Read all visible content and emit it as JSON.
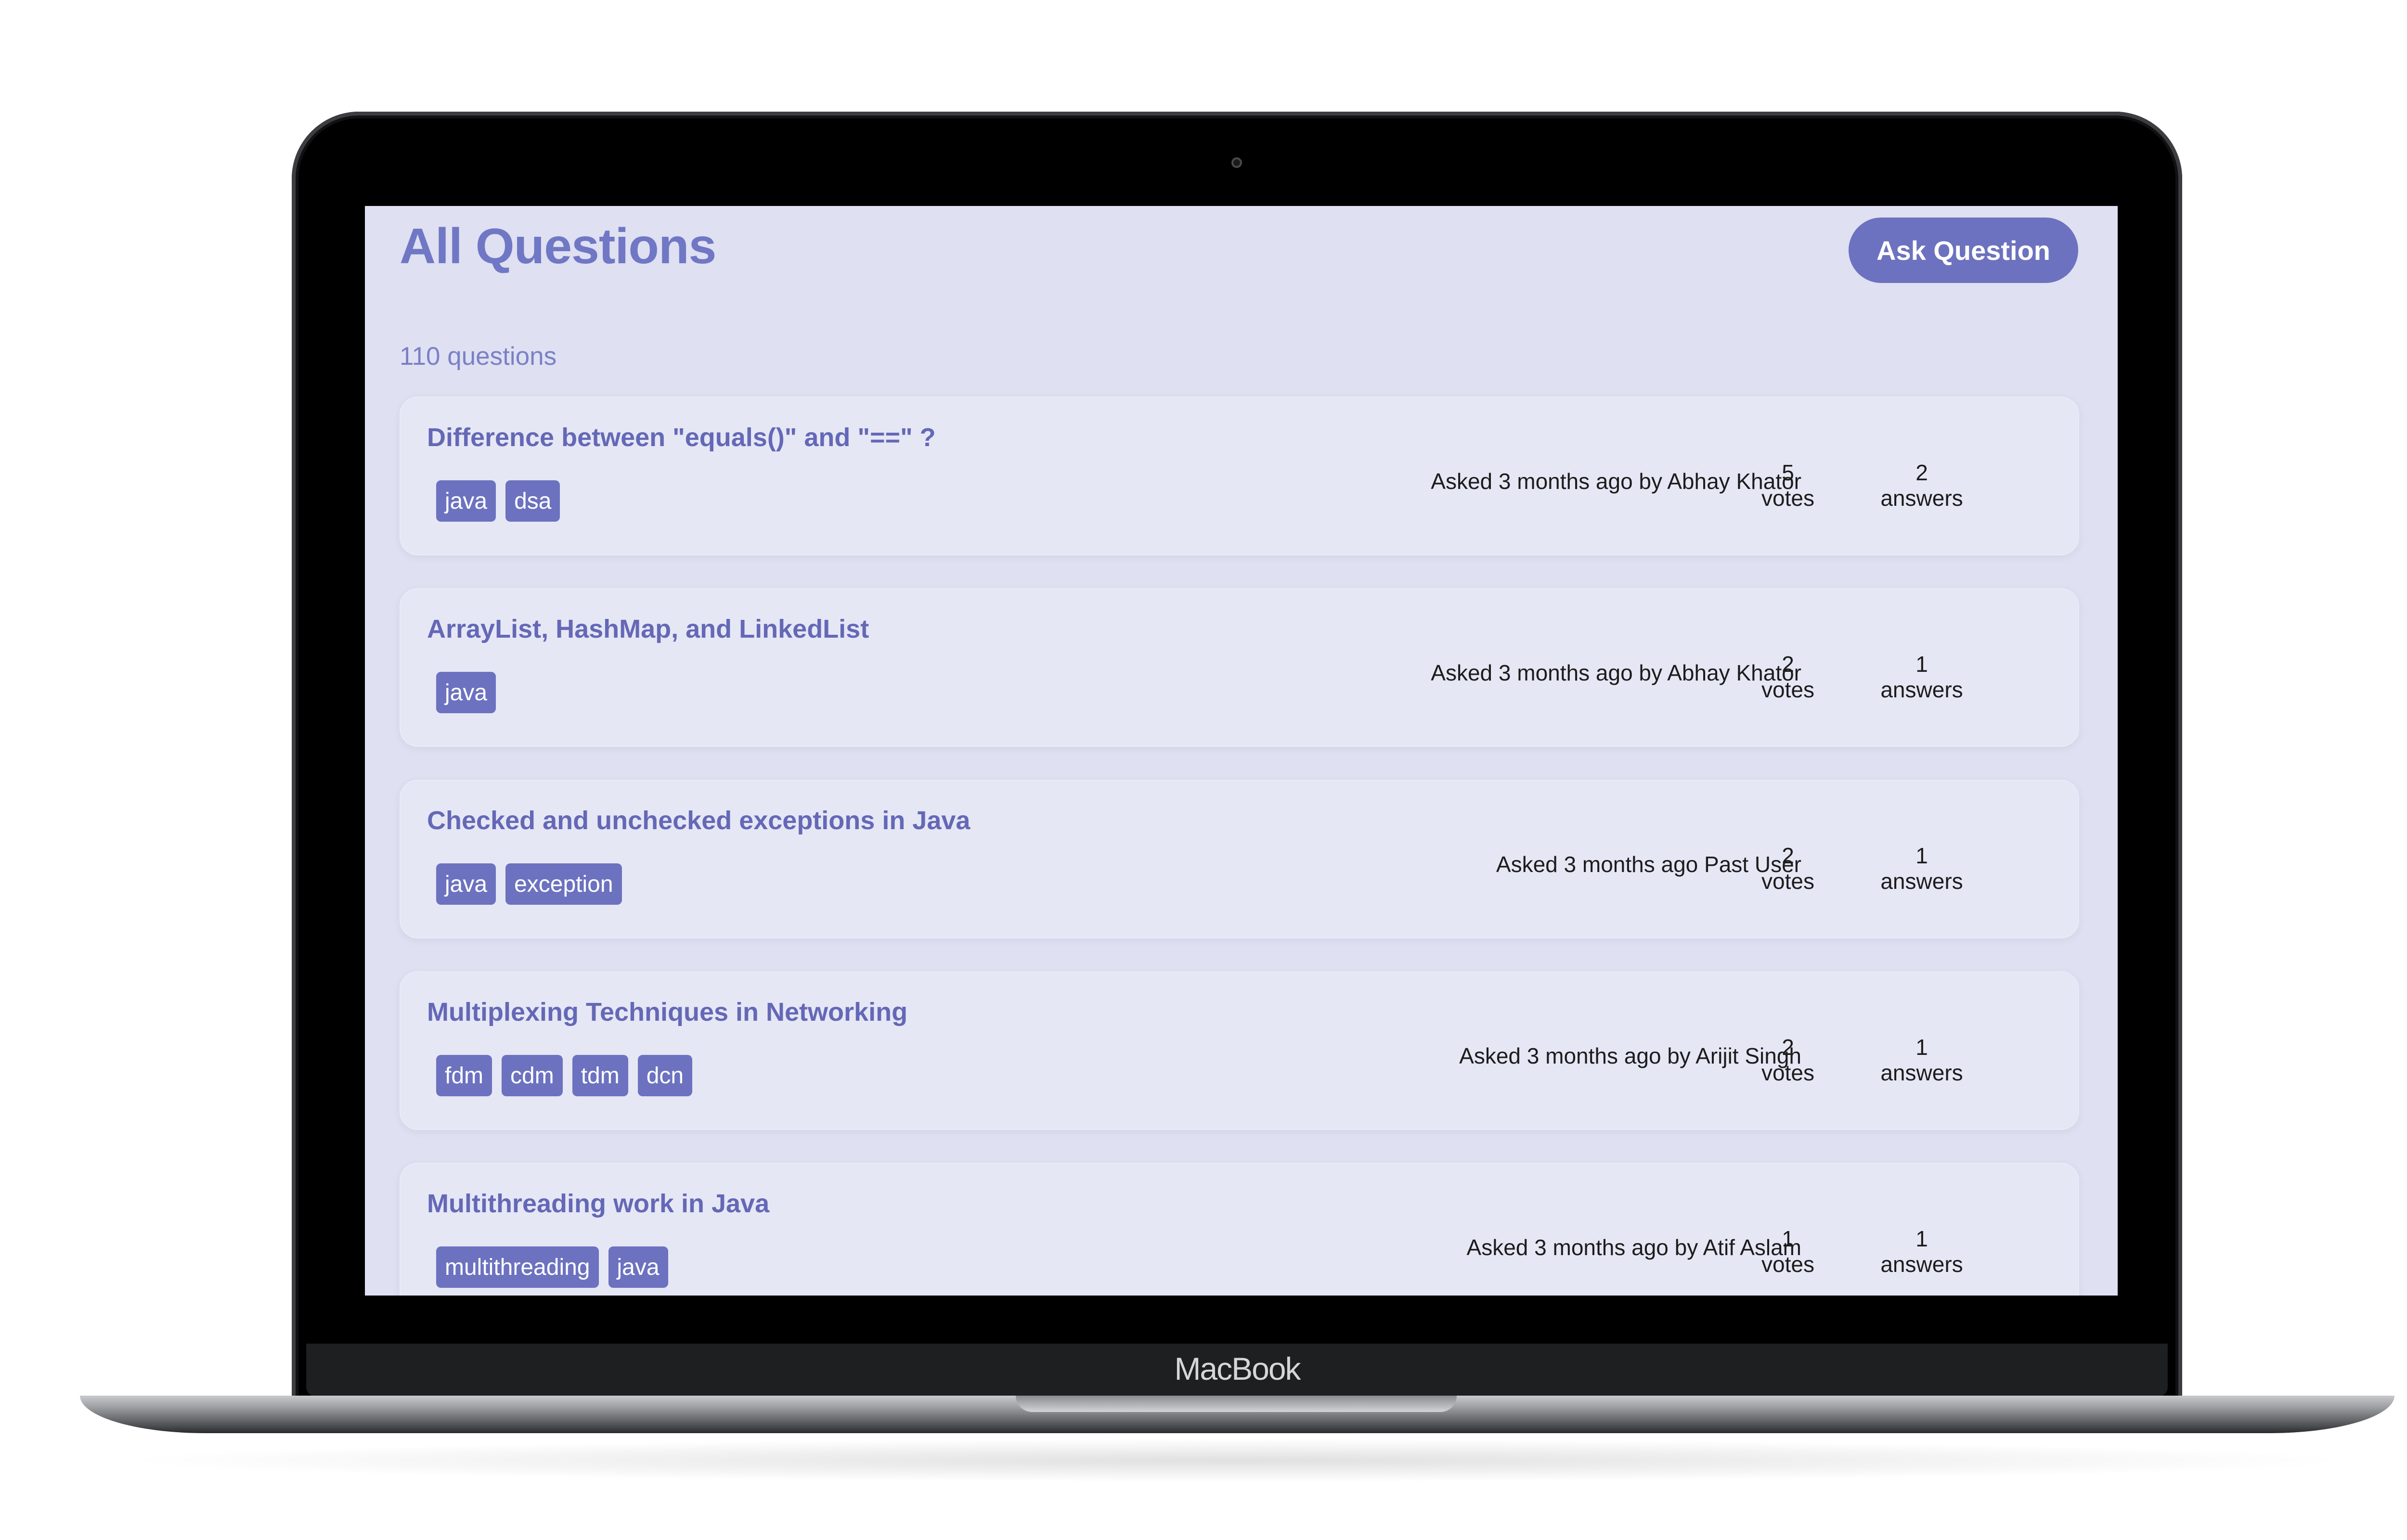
{
  "device": {
    "brand_label": "MacBook"
  },
  "page": {
    "title": "All Questions",
    "ask_button_label": "Ask Question",
    "question_count": "110 questions"
  },
  "questions": [
    {
      "title": "Difference between \"equals()\" and \"==\" ?",
      "tags": [
        "java",
        "dsa"
      ],
      "meta": "Asked 3 months ago by Abhay Khator",
      "votes": "5",
      "votes_label": "votes",
      "answers": "2",
      "answers_label": "answers"
    },
    {
      "title": "ArrayList, HashMap, and LinkedList",
      "tags": [
        "java"
      ],
      "meta": "Asked 3 months ago by Abhay Khator",
      "votes": "2",
      "votes_label": "votes",
      "answers": "1",
      "answers_label": "answers"
    },
    {
      "title": "Checked and unchecked exceptions in Java",
      "tags": [
        "java",
        "exception"
      ],
      "meta": "Asked 3 months ago Past User",
      "votes": "2",
      "votes_label": "votes",
      "answers": "1",
      "answers_label": "answers"
    },
    {
      "title": "Multiplexing Techniques in Networking",
      "tags": [
        "fdm",
        "cdm",
        "tdm",
        "dcn"
      ],
      "meta": "Asked 3 months ago by Arijit Singh",
      "votes": "2",
      "votes_label": "votes",
      "answers": "1",
      "answers_label": "answers"
    },
    {
      "title": "Multithreading work in Java",
      "tags": [
        "multithreading",
        "java"
      ],
      "meta": "Asked 3 months ago by Atif Aslam",
      "votes": "1",
      "votes_label": "votes",
      "answers": "1",
      "answers_label": "answers"
    }
  ]
}
